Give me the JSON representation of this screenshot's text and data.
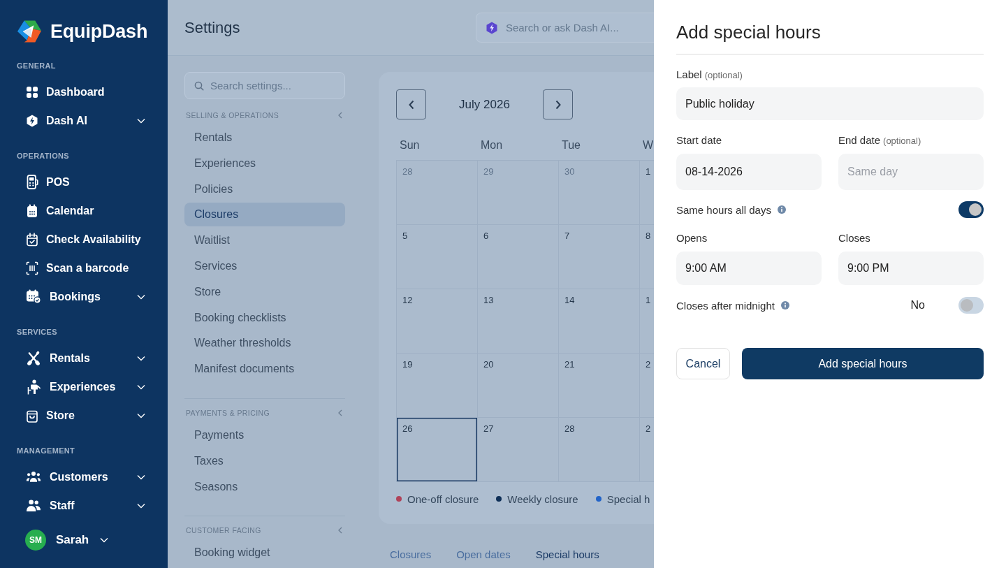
{
  "sidebar": {
    "brand": "EquipDash",
    "sections": [
      {
        "title": "GENERAL",
        "items": [
          {
            "label": "Dashboard",
            "expandable": false
          },
          {
            "label": "Dash AI",
            "expandable": true
          }
        ]
      },
      {
        "title": "OPERATIONS",
        "items": [
          {
            "label": "POS",
            "expandable": false
          },
          {
            "label": "Calendar",
            "expandable": false
          },
          {
            "label": "Check Availability",
            "expandable": false
          },
          {
            "label": "Scan a barcode",
            "expandable": false
          },
          {
            "label": "Bookings",
            "expandable": true
          }
        ]
      },
      {
        "title": "SERVICES",
        "items": [
          {
            "label": "Rentals",
            "expandable": true
          },
          {
            "label": "Experiences",
            "expandable": true
          },
          {
            "label": "Store",
            "expandable": true
          }
        ]
      },
      {
        "title": "MANAGEMENT",
        "items": [
          {
            "label": "Customers",
            "expandable": true
          },
          {
            "label": "Staff",
            "expandable": true
          }
        ]
      }
    ],
    "user": {
      "initials": "SM",
      "name": "Sarah"
    }
  },
  "header": {
    "title": "Settings",
    "search": {
      "placeholder": "Search or ask Dash AI..."
    }
  },
  "settings_nav": {
    "search": {
      "placeholder": "Search settings..."
    },
    "sections": [
      {
        "title": "SELLING & OPERATIONS",
        "items": [
          {
            "label": "Rentals",
            "selected": false
          },
          {
            "label": "Experiences",
            "selected": false
          },
          {
            "label": "Policies",
            "selected": false
          },
          {
            "label": "Closures",
            "selected": true
          },
          {
            "label": "Waitlist",
            "selected": false
          },
          {
            "label": "Services",
            "selected": false
          },
          {
            "label": "Store",
            "selected": false
          },
          {
            "label": "Booking checklists",
            "selected": false
          },
          {
            "label": "Weather thresholds",
            "selected": false
          },
          {
            "label": "Manifest documents",
            "selected": false
          }
        ]
      },
      {
        "title": "PAYMENTS & PRICING",
        "items": [
          {
            "label": "Payments",
            "selected": false
          },
          {
            "label": "Taxes",
            "selected": false
          },
          {
            "label": "Seasons",
            "selected": false
          }
        ]
      },
      {
        "title": "CUSTOMER FACING",
        "items": [
          {
            "label": "Booking widget",
            "selected": false
          }
        ]
      }
    ]
  },
  "calendar": {
    "month": "July 2026",
    "weekdays": [
      "Sun",
      "Mon",
      "Tue",
      "W"
    ],
    "weeks": [
      [
        {
          "day": "28",
          "in_month": false,
          "selected": false
        },
        {
          "day": "29",
          "in_month": false,
          "selected": false
        },
        {
          "day": "30",
          "in_month": false,
          "selected": false
        },
        {
          "day": "1",
          "in_month": true,
          "selected": false
        }
      ],
      [
        {
          "day": "5",
          "in_month": true,
          "selected": false
        },
        {
          "day": "6",
          "in_month": true,
          "selected": false
        },
        {
          "day": "7",
          "in_month": true,
          "selected": false
        },
        {
          "day": "8",
          "in_month": true,
          "selected": false
        }
      ],
      [
        {
          "day": "12",
          "in_month": true,
          "selected": false
        },
        {
          "day": "13",
          "in_month": true,
          "selected": false
        },
        {
          "day": "14",
          "in_month": true,
          "selected": false
        },
        {
          "day": "1",
          "in_month": true,
          "selected": false
        }
      ],
      [
        {
          "day": "19",
          "in_month": true,
          "selected": false
        },
        {
          "day": "20",
          "in_month": true,
          "selected": false
        },
        {
          "day": "21",
          "in_month": true,
          "selected": false
        },
        {
          "day": "2",
          "in_month": true,
          "selected": false
        }
      ],
      [
        {
          "day": "26",
          "in_month": true,
          "selected": true
        },
        {
          "day": "27",
          "in_month": true,
          "selected": false
        },
        {
          "day": "28",
          "in_month": true,
          "selected": false
        },
        {
          "day": "2",
          "in_month": true,
          "selected": false
        }
      ]
    ],
    "legend": [
      {
        "label": "One-off closure",
        "color": "#b0435a"
      },
      {
        "label": "Weekly closure",
        "color": "#0e2f57"
      },
      {
        "label": "Special h",
        "color": "#2264c8"
      }
    ]
  },
  "view_tabs": [
    {
      "label": "Closures",
      "selected": false
    },
    {
      "label": "Open dates",
      "selected": false
    },
    {
      "label": "Special hours",
      "selected": true
    }
  ],
  "drawer": {
    "title": "Add special hours",
    "label_field": {
      "label": "Label",
      "note": "(optional)",
      "value": "Public holiday"
    },
    "date_fields": [
      {
        "label": "Start date",
        "value": "08-14-2026"
      },
      {
        "label": "End date",
        "note": "(optional)",
        "placeholder": "Same day"
      }
    ],
    "same_hours": {
      "label": "Same hours all days",
      "on": true
    },
    "time_fields": [
      {
        "label": "Opens",
        "value": "9:00 AM"
      },
      {
        "label": "Closes",
        "value": "9:00 PM"
      }
    ],
    "after_midnight": {
      "label": "Closes after midnight",
      "reading": "No",
      "on": false
    },
    "cancel_button": "Cancel",
    "submit_button": "Add special hours"
  }
}
